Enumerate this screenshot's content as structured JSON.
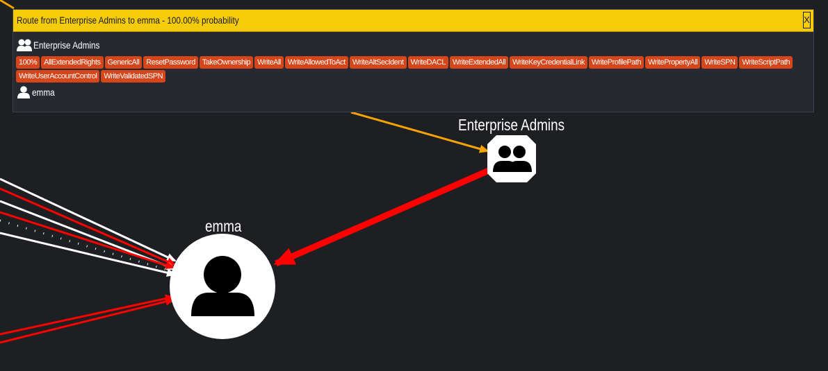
{
  "popup": {
    "title": "Route from Enterprise Admins to emma - 100.00% probability",
    "close_label": "X",
    "source_node": "Enterprise Admins",
    "edges": [
      "100%",
      "AllExtendedRights",
      "GenericAll",
      "ResetPassword",
      "TakeOwnership",
      "WriteAll",
      "WriteAllowedToAct",
      "WriteAltSecIdent",
      "WriteDACL",
      "WriteExtendedAll",
      "WriteKeyCredentialLink",
      "WriteProfilePath",
      "WritePropertyAll",
      "WriteSPN",
      "WriteScriptPath",
      "WriteUserAccountControl",
      "WriteValidatedSPN"
    ],
    "target_node": "emma",
    "header_color": "#f5cc0a",
    "badge_color": "#d7461a"
  },
  "graph": {
    "nodes": [
      {
        "label": "Enterprise Admins",
        "type": "group",
        "icon": "users-icon"
      },
      {
        "label": "emma",
        "type": "user",
        "icon": "user-icon"
      }
    ],
    "edge_colors": {
      "path": "#ff0000",
      "other": "#ffffff",
      "incoming": "#f5a300"
    }
  }
}
